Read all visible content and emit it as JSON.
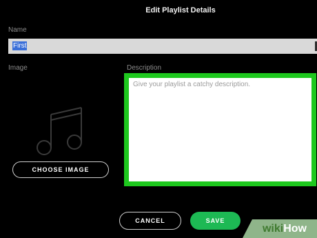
{
  "dialog": {
    "title": "Edit Playlist Details"
  },
  "name": {
    "label": "Name",
    "value": "First"
  },
  "image": {
    "label": "Image",
    "placeholder_icon": "music-note-icon",
    "choose_label": "CHOOSE IMAGE"
  },
  "description": {
    "label": "Description",
    "placeholder": "Give your playlist a catchy description.",
    "highlight_color": "#1ec81e"
  },
  "actions": {
    "cancel_label": "CANCEL",
    "save_label": "SAVE",
    "save_color": "#1db954"
  },
  "watermark": {
    "prefix": "wiki",
    "suffix": "How"
  }
}
